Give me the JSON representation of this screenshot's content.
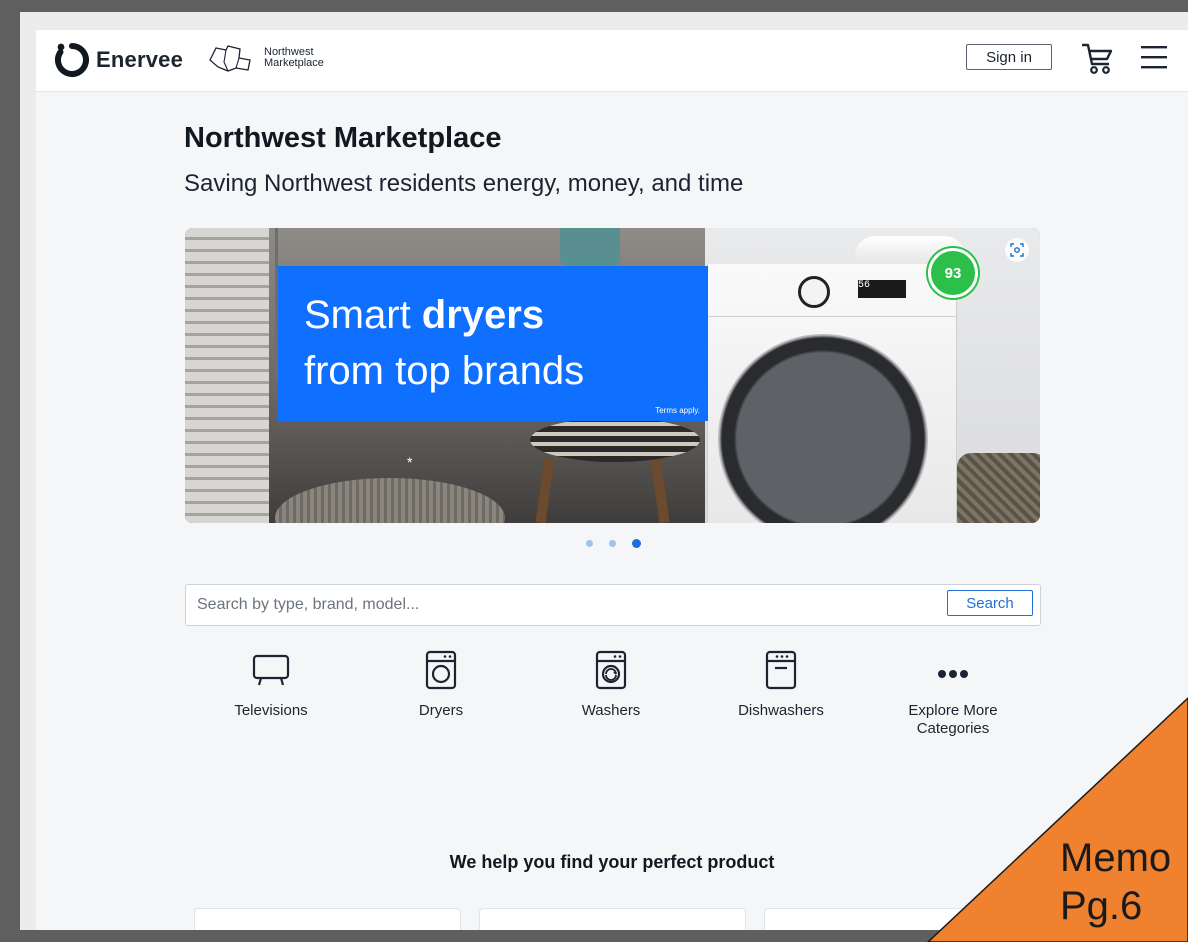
{
  "header": {
    "brand_name": "Enervee",
    "partner_line1": "Northwest",
    "partner_line2": "Marketplace",
    "signin_label": "Sign in"
  },
  "hero": {
    "title": "Northwest Marketplace",
    "subtitle": "Saving Northwest residents energy, money, and time"
  },
  "banner": {
    "line1_pre": "Smart ",
    "line1_bold": "dryers",
    "line2": "from top brands",
    "terms": "Terms apply.",
    "asterisk": "*",
    "score": "93",
    "dryer_display": "56",
    "slides_total": 3,
    "active_slide": 3
  },
  "search": {
    "placeholder": "Search by type, brand, model...",
    "button_label": "Search"
  },
  "categories": [
    {
      "label": "Televisions",
      "icon": "tv-icon"
    },
    {
      "label": "Dryers",
      "icon": "dryer-icon"
    },
    {
      "label": "Washers",
      "icon": "washer-icon"
    },
    {
      "label": "Dishwashers",
      "icon": "dishwasher-icon"
    },
    {
      "label": "Explore More Categories",
      "icon": "more-dots-icon"
    }
  ],
  "section": {
    "heading": "We help you find your perfect product"
  },
  "overlay": {
    "line1": "Memo",
    "line2": "Pg.6",
    "color": "#f0812e"
  },
  "colors": {
    "accent": "#1e6fd9",
    "promo_blue": "#0f6fff",
    "score_green": "#2cc04a"
  }
}
